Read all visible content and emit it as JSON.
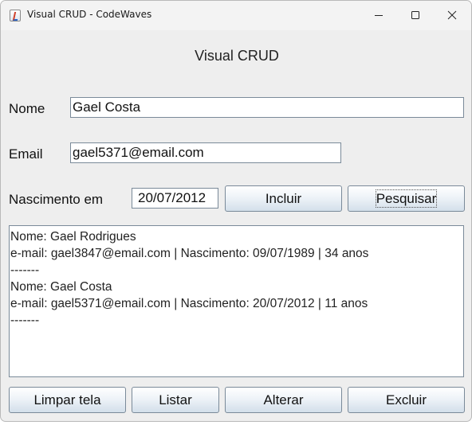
{
  "window": {
    "title": "Visual CRUD - CodeWaves",
    "icons": {
      "app": "java-app-icon",
      "minimize": "minimize-icon",
      "maximize": "maximize-icon",
      "close": "close-icon"
    }
  },
  "form": {
    "heading": "Visual CRUD",
    "nome_label": "Nome",
    "nome_value": "Gael Costa",
    "email_label": "Email",
    "email_value": "gael5371@email.com",
    "nascimento_label": "Nascimento em",
    "nascimento_value": "20/07/2012"
  },
  "buttons": {
    "incluir": "Incluir",
    "pesquisar": "Pesquisar",
    "limpar": "Limpar tela",
    "listar": "Listar",
    "alterar": "Alterar",
    "excluir": "Excluir"
  },
  "output": {
    "lines": [
      "Nome: Gael Rodrigues",
      "e-mail: gael3847@email.com | Nascimento: 09/07/1989 | 34 anos",
      "-------",
      "Nome: Gael Costa",
      "e-mail: gael5371@email.com | Nascimento: 20/07/2012 | 11 anos",
      "-------"
    ]
  }
}
